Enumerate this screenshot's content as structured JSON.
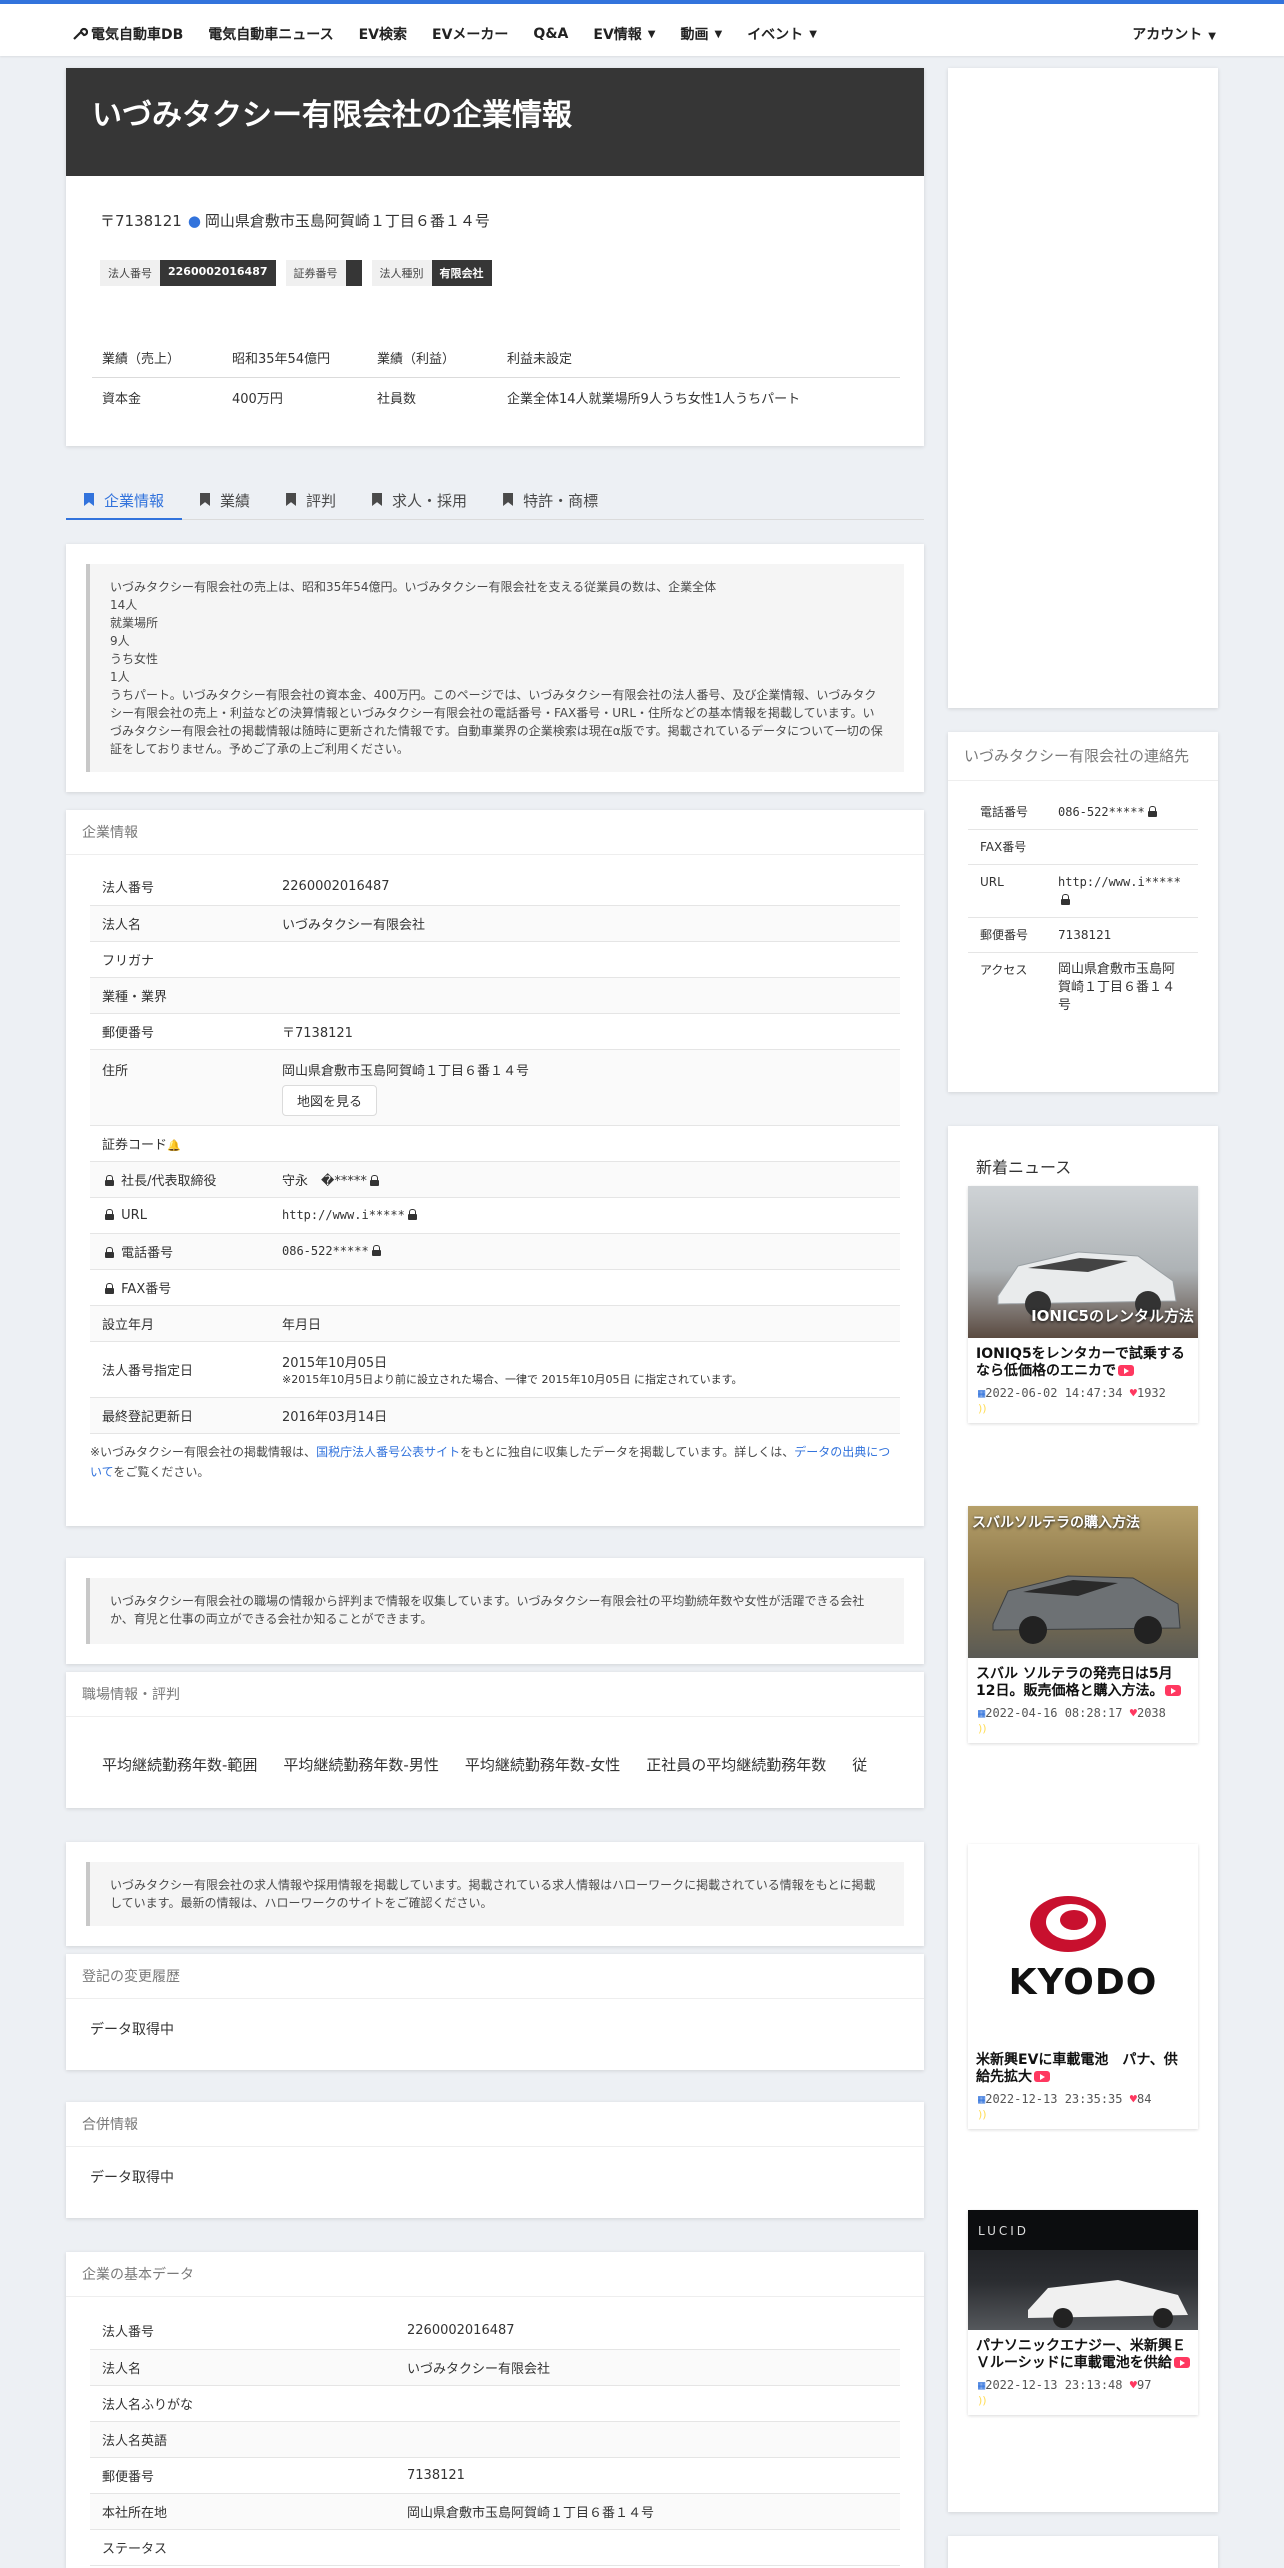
{
  "nav": {
    "brand": "電気自動車DB",
    "items": [
      {
        "label": "電気自動車ニュース",
        "caret": false
      },
      {
        "label": "EV検索",
        "caret": false
      },
      {
        "label": "EVメーカー",
        "caret": false
      },
      {
        "label": "Q&A",
        "caret": false
      },
      {
        "label": "EV情報",
        "caret": true
      },
      {
        "label": "動画",
        "caret": true
      },
      {
        "label": "イベント",
        "caret": true
      }
    ],
    "account": "アカウント"
  },
  "hero": {
    "title": "いづみタクシー有限会社の企業情報"
  },
  "address": {
    "postal": "〒7138121",
    "location": "岡山県倉敷市玉島阿賀崎１丁目６番１４号"
  },
  "tags": [
    {
      "key": "法人番号",
      "value": "2260002016487"
    },
    {
      "key": "証券番号",
      "value": ""
    },
    {
      "key": "法人種別",
      "value": "有限会社"
    }
  ],
  "performance": [
    [
      "業績（売上）",
      "昭和35年54億円",
      "業績（利益）",
      "利益未設定"
    ],
    [
      "資本金",
      "400万円",
      "社員数",
      "企業全体14人就業場所9人うち女性1人うちパート"
    ]
  ],
  "tabs": [
    "企業情報",
    "業績",
    "評判",
    "求人・採用",
    "特許・商標"
  ],
  "intro": "いづみタクシー有限会社の売上は、昭和35年54億円。いづみタクシー有限会社を支える従業員の数は、企業全体\n14人\n就業場所\n9人\nうち女性\n1人\nうちパート。いづみタクシー有限会社の資本金、400万円。このページでは、いづみタクシー有限会社の法人番号、及び企業情報、いづみタクシー有限会社の売上・利益などの決算情報といづみタクシー有限会社の電話番号・FAX番号・URL・住所などの基本情報を掲載しています。いづみタクシー有限会社の掲載情報は随時に更新された情報です。自動車業界の企業検索は現在α版です。掲載されているデータについて一切の保証をしておりません。予めご了承の上ご利用ください。",
  "company": {
    "heading": "企業情報",
    "rows": [
      {
        "label": "法人番号",
        "value": "2260002016487",
        "lock": false
      },
      {
        "label": "法人名",
        "value": "いづみタクシー有限会社",
        "lock": false
      },
      {
        "label": "フリガナ",
        "value": "",
        "lock": false
      },
      {
        "label": "業種・業界",
        "value": "",
        "lock": false
      },
      {
        "label": "郵便番号",
        "value": "〒7138121",
        "lock": false
      },
      {
        "label": "住所",
        "value": "岡山県倉敷市玉島阿賀崎１丁目６番１４号",
        "lock": false,
        "button": "地図を見る"
      },
      {
        "label": "証券コード",
        "value": "",
        "lock": false,
        "bell": true
      },
      {
        "label": "社長/代表取締役",
        "value": "守永　�*****",
        "lock": true,
        "vlock": true
      },
      {
        "label": "URL",
        "value": "http://www.i*****",
        "lock": true,
        "vlock": true,
        "mono": true
      },
      {
        "label": "電話番号",
        "value": "086-522*****",
        "lock": true,
        "vlock": true,
        "mono": true
      },
      {
        "label": "FAX番号",
        "value": "",
        "lock": true
      },
      {
        "label": "設立年月",
        "value": "年月日",
        "lock": false
      },
      {
        "label": "法人番号指定日",
        "value": "2015年10月05日",
        "lock": false,
        "note": "※2015年10月5日より前に設立された場合、一律で 2015年10月05日 に指定されています。"
      },
      {
        "label": "最終登記更新日",
        "value": "2016年03月14日",
        "lock": false
      }
    ],
    "source_pre": "※いづみタクシー有限会社の掲載情報は、",
    "source_link1": "国税庁法人番号公表サイト",
    "source_mid": "をもとに独自に収集したデータを掲載しています。詳しくは、",
    "source_link2": "データの出典について",
    "source_post": "をご覧ください。"
  },
  "workplace_note": "いづみタクシー有限会社の職場の情報から評判まで情報を収集しています。いづみタクシー有限会社の平均勤続年数や女性が活躍できる会社か、育児と仕事の両立ができる会社か知ることができます。",
  "workplace": {
    "heading": "職場情報・評判",
    "items": [
      "平均継続勤務年数-範囲",
      "平均継続勤務年数-男性",
      "平均継続勤務年数-女性",
      "正社員の平均継続勤務年数",
      "従"
    ]
  },
  "jobs_note": "いづみタクシー有限会社の求人情報や採用情報を掲載しています。掲載されている求人情報はハローワークに掲載されている情報をもとに掲載しています。最新の情報は、ハローワークのサイトをご確認ください。",
  "registry": {
    "heading": "登記の変更履歴",
    "body": "データ取得中"
  },
  "merger": {
    "heading": "合併情報",
    "body": "データ取得中"
  },
  "basic": {
    "heading": "企業の基本データ",
    "rows": [
      {
        "label": "法人番号",
        "value": "2260002016487"
      },
      {
        "label": "法人名",
        "value": "いづみタクシー有限会社"
      },
      {
        "label": "法人名ふりがな",
        "value": ""
      },
      {
        "label": "法人名英語",
        "value": ""
      },
      {
        "label": "郵便番号",
        "value": "7138121"
      },
      {
        "label": "本社所在地",
        "value": "岡山県倉敷市玉島阿賀崎１丁目６番１４号"
      },
      {
        "label": "ステータス",
        "value": ""
      }
    ]
  },
  "contact": {
    "heading": "いづみタクシー有限会社の連絡先",
    "rows": [
      {
        "label": "電話番号",
        "value": "086-522*****",
        "lock": true
      },
      {
        "label": "FAX番号",
        "value": "",
        "lock": false
      },
      {
        "label": "URL",
        "value": "http://www.i*****",
        "lock": true
      },
      {
        "label": "郵便番号",
        "value": "7138121",
        "lock": false
      },
      {
        "label": "アクセス",
        "value": "岡山県倉敷市玉島阿賀崎１丁目６番１４号",
        "lock": false
      }
    ]
  },
  "news": {
    "heading": "新着ニュース",
    "items": [
      {
        "title": "IONIQ5をレンタカーで試乗するなら低価格のエニカで",
        "overlay": "IONIC5のレンタル方法",
        "date": "2022-06-02 14:47:34",
        "likes": "1932"
      },
      {
        "title": "スバル ソルテラの発売日は5月12日。販売価格と購入方法。",
        "overlay": "スバルソルテラの購入方法",
        "date": "2022-04-16 08:28:17",
        "likes": "2038"
      },
      {
        "title": "米新興EVに車載電池　パナ、供給先拡大",
        "overlay": "KYODO",
        "date": "2022-12-13 23:35:35",
        "likes": "84"
      },
      {
        "title": "パナソニックエナジー、米新興ＥＶルーシッドに車載電池を供給",
        "overlay": "LUCID",
        "date": "2022-12-13 23:13:48",
        "likes": "97"
      }
    ]
  }
}
